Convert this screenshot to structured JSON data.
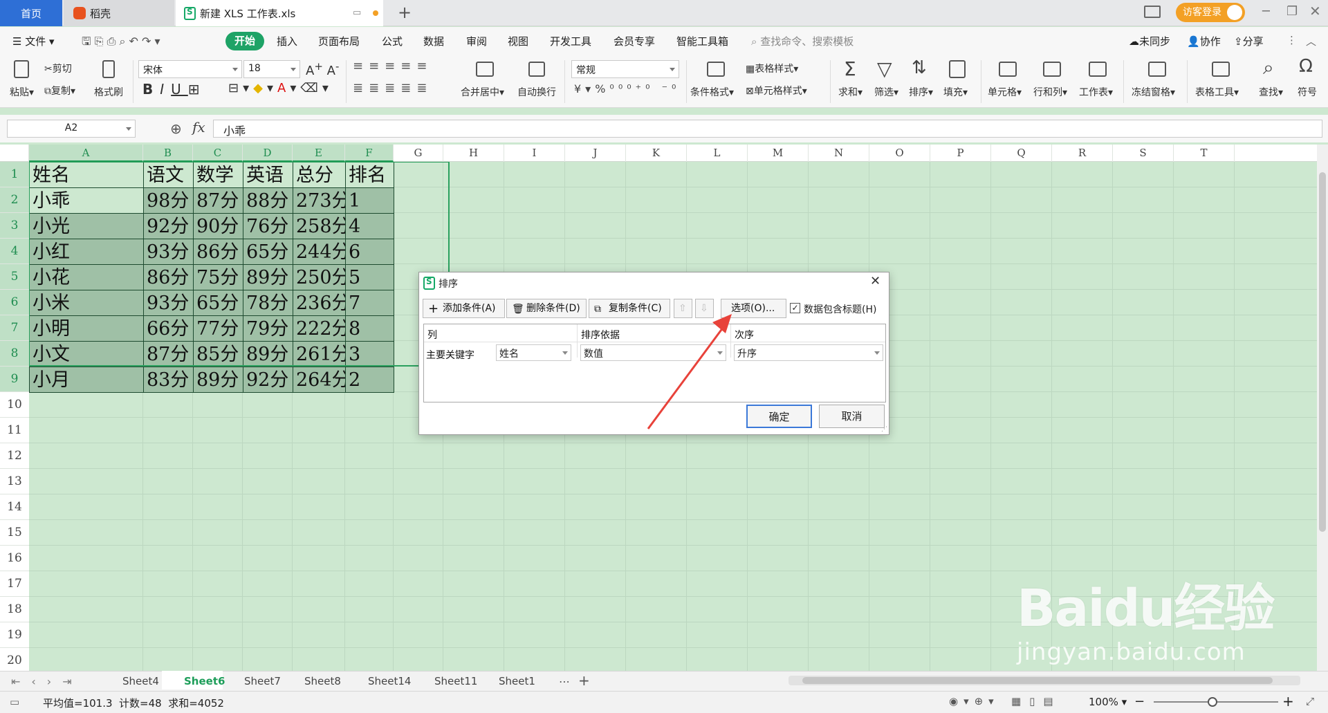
{
  "tabs": {
    "home": "首页",
    "daoke": "稻壳",
    "doc": "新建 XLS 工作表.xls",
    "login": "访客登录"
  },
  "menu": {
    "file": "文件",
    "items": [
      "开始",
      "插入",
      "页面布局",
      "公式",
      "数据",
      "审阅",
      "视图",
      "开发工具",
      "会员专享",
      "智能工具箱"
    ],
    "search": "查找命令、搜索模板",
    "sync": "未同步",
    "collab": "协作",
    "share": "分享"
  },
  "ribbon": {
    "paste": "粘贴",
    "cut": "剪切",
    "copy": "复制",
    "format_painter": "格式刷",
    "font": "宋体",
    "font_size": "18",
    "merge": "合并居中",
    "wrap": "自动换行",
    "number_format": "常规",
    "cond_format": "条件格式",
    "table_style": "表格样式",
    "cell_style": "单元格样式",
    "sum": "求和",
    "filter": "筛选",
    "sort": "排序",
    "fill": "填充",
    "cell": "单元格",
    "rowcol": "行和列",
    "worksheet": "工作表",
    "freeze": "冻结窗格",
    "table_tools": "表格工具",
    "find": "查找",
    "symbol": "符号"
  },
  "formula_bar": {
    "name_box": "A2",
    "fx": "fx",
    "content": "小乖"
  },
  "columns": [
    "A",
    "B",
    "C",
    "D",
    "E",
    "F",
    "G",
    "H",
    "I",
    "J",
    "K",
    "L",
    "M",
    "N",
    "O",
    "P",
    "Q",
    "R",
    "S",
    "T"
  ],
  "rows": [
    "1",
    "2",
    "3",
    "4",
    "5",
    "6",
    "7",
    "8",
    "9",
    "10",
    "11",
    "12",
    "13",
    "14",
    "15",
    "16",
    "17",
    "18",
    "19",
    "20"
  ],
  "table": {
    "header": [
      "姓名",
      "语文",
      "数学",
      "英语",
      "总分",
      "排名"
    ],
    "rows": [
      [
        "小乖",
        "98分",
        "87分",
        "88分",
        "273分",
        "1"
      ],
      [
        "小光",
        "92分",
        "90分",
        "76分",
        "258分",
        "4"
      ],
      [
        "小红",
        "93分",
        "86分",
        "65分",
        "244分",
        "6"
      ],
      [
        "小花",
        "86分",
        "75分",
        "89分",
        "250分",
        "5"
      ],
      [
        "小米",
        "93分",
        "65分",
        "78分",
        "236分",
        "7"
      ],
      [
        "小明",
        "66分",
        "77分",
        "79分",
        "222分",
        "8"
      ],
      [
        "小文",
        "87分",
        "85分",
        "89分",
        "261分",
        "3"
      ],
      [
        "小月",
        "83分",
        "89分",
        "92分",
        "264分",
        "2"
      ]
    ]
  },
  "dialog": {
    "title": "排序",
    "add": "添加条件(A)",
    "delete": "删除条件(D)",
    "copy": "复制条件(C)",
    "options": "选项(O)...",
    "has_header": "数据包含标题(H)",
    "col_header": "列",
    "basis_header": "排序依据",
    "order_header": "次序",
    "key_label": "主要关键字",
    "key_value": "姓名",
    "basis_value": "数值",
    "order_value": "升序",
    "ok": "确定",
    "cancel": "取消"
  },
  "sheets": [
    "Sheet4",
    "Sheet6",
    "Sheet7",
    "Sheet8",
    "Sheet14",
    "Sheet11",
    "Sheet1"
  ],
  "active_sheet": "Sheet6",
  "status": {
    "summary": "平均值=101.3  计数=48  求和=4052",
    "zoom": "100%"
  },
  "watermark": {
    "line1": "Baidu经验",
    "line2": "jingyan.baidu.com"
  },
  "colors": {
    "accent": "#1ea366",
    "home_tab": "#2e6fd6",
    "login": "#f3a025",
    "arrow": "#e8423a"
  }
}
